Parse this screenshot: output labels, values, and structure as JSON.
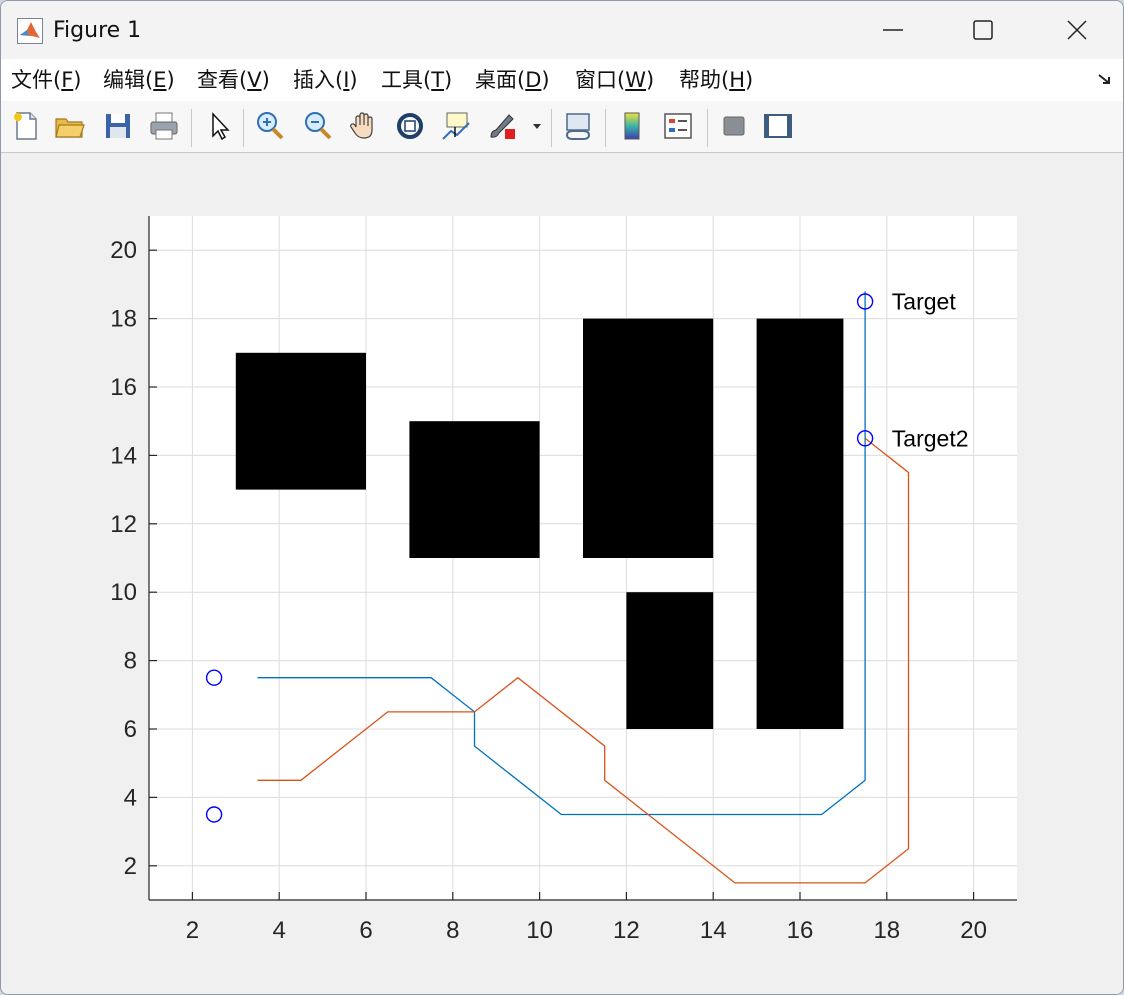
{
  "window": {
    "title": "Figure 1",
    "controls": {
      "minimize": "minimize-icon",
      "maximize": "maximize-icon",
      "close": "close-icon"
    }
  },
  "menu": {
    "items": [
      {
        "label": "文件(",
        "accel": "F",
        "suffix": ")"
      },
      {
        "label": "编辑(",
        "accel": "E",
        "suffix": ")"
      },
      {
        "label": "查看(",
        "accel": "V",
        "suffix": ")"
      },
      {
        "label": "插入(",
        "accel": "I",
        "suffix": ")"
      },
      {
        "label": "工具(",
        "accel": "T",
        "suffix": ")"
      },
      {
        "label": "桌面(",
        "accel": "D",
        "suffix": ")"
      },
      {
        "label": "窗口(",
        "accel": "W",
        "suffix": ")"
      },
      {
        "label": "帮助(",
        "accel": "H",
        "suffix": ")"
      }
    ]
  },
  "toolbar": {
    "icons": [
      "new-figure-icon",
      "open-folder-icon",
      "save-icon",
      "print-icon",
      "select-arrow-icon",
      "zoom-in-icon",
      "zoom-out-icon",
      "pan-hand-icon",
      "rotate-3d-icon",
      "data-cursor-icon",
      "brush-icon",
      "link-plot-icon",
      "colorbar-icon",
      "legend-icon",
      "hide-plot-tools-icon",
      "show-plot-tools-icon"
    ]
  },
  "colors": {
    "series1": "#0072BD",
    "series2": "#D95319",
    "obstacle": "#000000",
    "marker": "#0000FF",
    "grid": "#dcdcdc",
    "axes_bg": "#ffffff"
  },
  "chart_data": {
    "type": "line",
    "title": "",
    "xlabel": "",
    "ylabel": "",
    "xlim": [
      1,
      21
    ],
    "ylim": [
      1,
      21
    ],
    "xticks": [
      2,
      4,
      6,
      8,
      10,
      12,
      14,
      16,
      18,
      20
    ],
    "yticks": [
      2,
      4,
      6,
      8,
      10,
      12,
      14,
      16,
      18,
      20
    ],
    "grid": true,
    "obstacles": [
      {
        "x": [
          3,
          6
        ],
        "y": [
          13,
          17
        ]
      },
      {
        "x": [
          7,
          10
        ],
        "y": [
          11,
          15
        ]
      },
      {
        "x": [
          11,
          14
        ],
        "y": [
          11,
          18
        ]
      },
      {
        "x": [
          12,
          14
        ],
        "y": [
          6,
          10
        ]
      },
      {
        "x": [
          15,
          17
        ],
        "y": [
          6,
          18
        ]
      }
    ],
    "series": [
      {
        "color": "#0072BD",
        "x": [
          3.5,
          7.5,
          8.5,
          8.5,
          10.5,
          16.5,
          17.5,
          17.5
        ],
        "y": [
          7.5,
          7.5,
          6.5,
          5.5,
          3.5,
          3.5,
          4.5,
          18.8
        ]
      },
      {
        "color": "#D95319",
        "x": [
          3.5,
          4.5,
          6.5,
          8.5,
          9.5,
          11.5,
          11.5,
          14.5,
          17.5,
          18.5,
          18.5,
          17.5
        ],
        "y": [
          4.5,
          4.5,
          6.5,
          6.5,
          7.5,
          5.5,
          4.5,
          1.5,
          1.5,
          2.5,
          13.5,
          14.5
        ]
      }
    ],
    "markers": [
      {
        "x": 2.5,
        "y": 7.5
      },
      {
        "x": 2.5,
        "y": 3.5
      },
      {
        "x": 17.5,
        "y": 18.5
      },
      {
        "x": 17.5,
        "y": 14.5
      }
    ],
    "annotations": [
      {
        "text": "Target",
        "x": 18,
        "y": 18.5
      },
      {
        "text": "Target2",
        "x": 18,
        "y": 14.5
      }
    ]
  }
}
